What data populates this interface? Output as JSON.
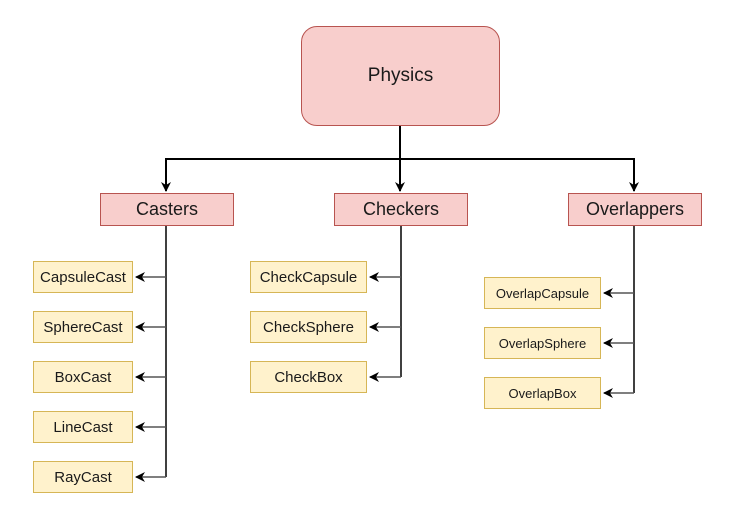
{
  "diagram": {
    "root": {
      "label": "Physics"
    },
    "categories": [
      {
        "label": "Casters",
        "children": [
          "CapsuleCast",
          "SphereCast",
          "BoxCast",
          "LineCast",
          "RayCast"
        ]
      },
      {
        "label": "Checkers",
        "children": [
          "CheckCapsule",
          "CheckSphere",
          "CheckBox"
        ]
      },
      {
        "label": "Overlappers",
        "children": [
          "OverlapCapsule",
          "OverlapSphere",
          "OverlapBox"
        ]
      }
    ],
    "colors": {
      "root_fill": "#f8cecc",
      "root_stroke": "#b85450",
      "leaf_fill": "#fff2cc",
      "leaf_stroke": "#d6b656",
      "connector_primary": "#000000",
      "connector_secondary": "#555555"
    }
  }
}
